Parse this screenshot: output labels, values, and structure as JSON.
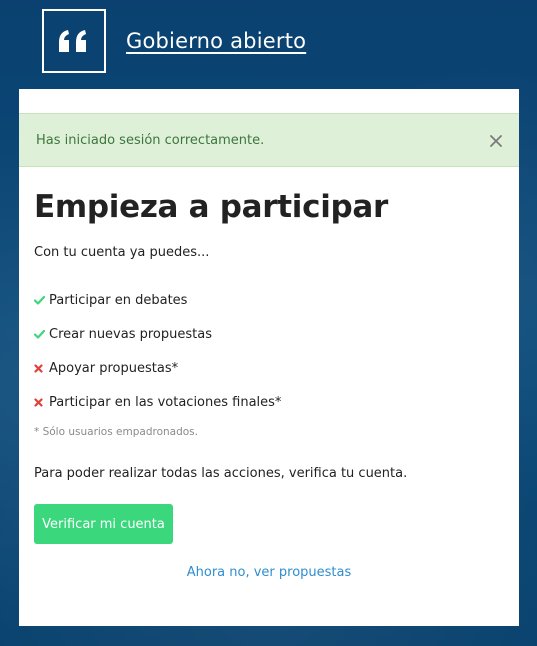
{
  "header": {
    "logo_icon": "quote-icon",
    "site_link": "Gobierno abierto"
  },
  "alert": {
    "message": "Has iniciado sesión correctamente.",
    "close_icon": "close-icon"
  },
  "main": {
    "title": "Empieza a participar",
    "intro": "Con tu cuenta ya puedes...",
    "abilities": [
      {
        "label": "Participar en debates",
        "allowed": true
      },
      {
        "label": "Crear nuevas propuestas",
        "allowed": true
      },
      {
        "label": "Apoyar propuestas*",
        "allowed": false
      },
      {
        "label": "Participar en las votaciones finales*",
        "allowed": false
      }
    ],
    "note": "* Sólo usuarios empadronados.",
    "verify_text": "Para poder realizar todas las acciones, verifica tu cuenta.",
    "verify_button": "Verificar mi cuenta",
    "later_link": "Ahora no, ver propuestas"
  },
  "colors": {
    "check": "#3bd77d",
    "cross": "#e0413a",
    "accent_link": "#2e8ed1",
    "alert_bg": "#dff0d8",
    "alert_text": "#3c763d"
  }
}
